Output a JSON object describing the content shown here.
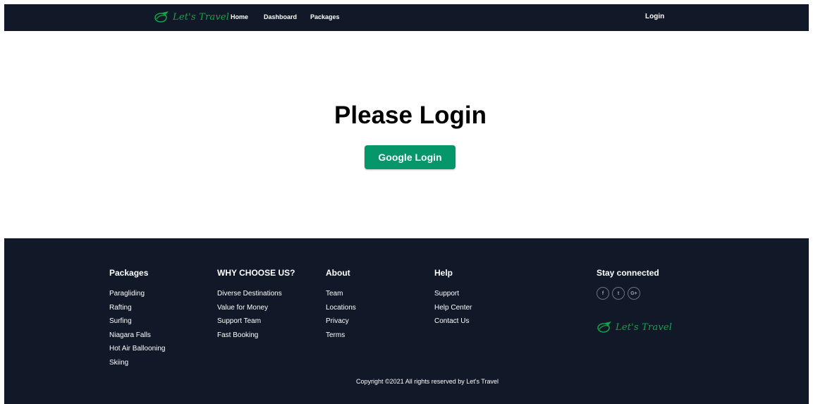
{
  "brand": {
    "name": "Let's Travel",
    "color": "#16a34a",
    "logo_icon": "globe-plane-icon"
  },
  "navbar": {
    "links": [
      {
        "label": "Home"
      },
      {
        "label": "Dashboard"
      },
      {
        "label": "Packages"
      }
    ],
    "login_label": "Login"
  },
  "main": {
    "title": "Please Login",
    "google_login_label": "Google Login"
  },
  "footer": {
    "columns": [
      {
        "heading": "Packages",
        "items": [
          "Paragliding",
          "Rafting",
          "Surfing",
          "Niagara Falls",
          "Hot Air Ballooning",
          "Skiing"
        ]
      },
      {
        "heading": "WHY CHOOSE US?",
        "items": [
          "Diverse Destinations",
          "Value for Money",
          "Support Team",
          "Fast Booking"
        ]
      },
      {
        "heading": "About",
        "items": [
          "Team",
          "Locations",
          "Privacy",
          "Terms"
        ]
      },
      {
        "heading": "Help",
        "items": [
          "Support",
          "Help Center",
          "Contact Us"
        ]
      }
    ],
    "stay_connected": {
      "heading": "Stay connected",
      "socials": [
        {
          "icon": "facebook-icon",
          "glyph": "f"
        },
        {
          "icon": "twitter-icon",
          "glyph": "t"
        },
        {
          "icon": "google-plus-icon",
          "glyph": "G+"
        }
      ]
    },
    "copyright": "Copyright ©2021 All rights reserved by Let's Travel"
  },
  "colors": {
    "dark_bg": "#111827",
    "accent_green": "#059669",
    "brand_green": "#16a34a"
  }
}
